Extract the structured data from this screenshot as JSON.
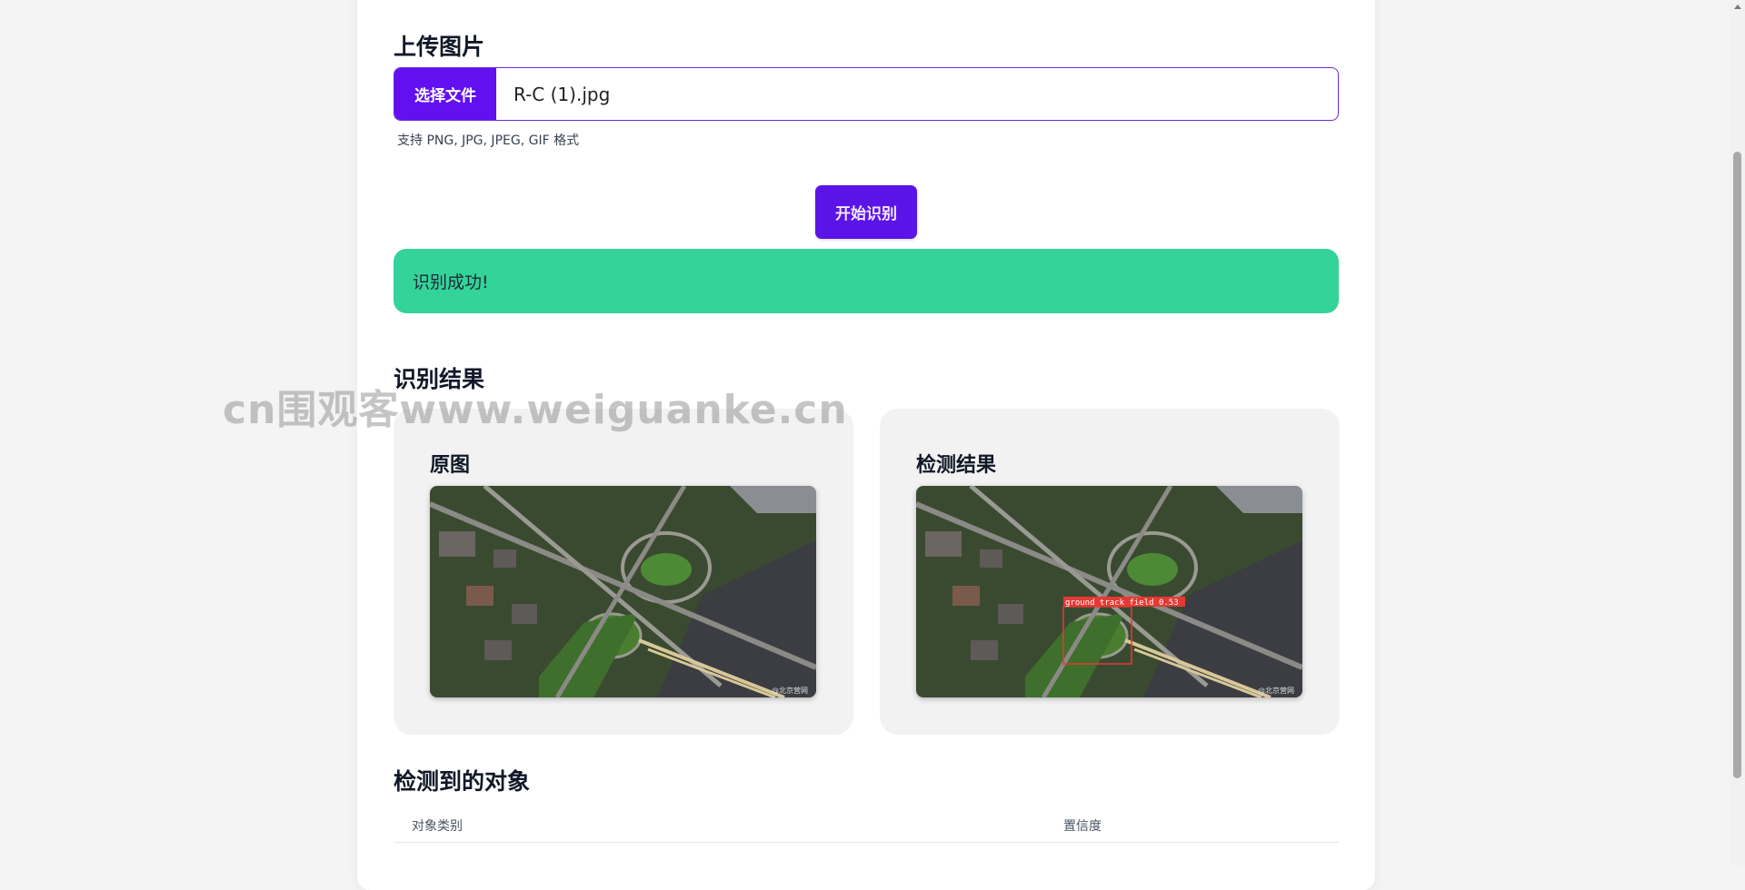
{
  "upload": {
    "title": "上传图片",
    "choose_label": "选择文件",
    "file_name": "R-C (1).jpg",
    "hint": "支持 PNG, JPG, JPEG, GIF 格式"
  },
  "actions": {
    "start_label": "开始识别"
  },
  "status": {
    "message": "识别成功!",
    "color": "#34d399"
  },
  "results": {
    "title": "识别结果",
    "original_title": "原图",
    "detection_title": "检测结果",
    "detection_label": "ground track field 0.53",
    "image_watermark": "@北京营网"
  },
  "objects": {
    "title": "检测到的对象",
    "columns": [
      "对象类别",
      "置信度"
    ]
  },
  "watermark": "cn围观客www.weiguanke.cn",
  "theme": {
    "accent": "#6210f0",
    "success": "#34d399"
  }
}
